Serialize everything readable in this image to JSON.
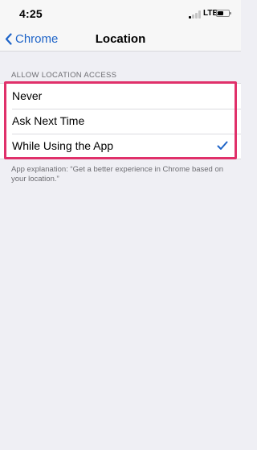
{
  "status_bar": {
    "time": "4:25",
    "network": "LTE",
    "battery_level": 0.55
  },
  "nav": {
    "back_label": "Chrome",
    "title": "Location"
  },
  "section": {
    "header": "ALLOW LOCATION ACCESS",
    "options": [
      {
        "label": "Never",
        "selected": false
      },
      {
        "label": "Ask Next Time",
        "selected": false
      },
      {
        "label": "While Using the App",
        "selected": true
      }
    ],
    "footer": "App explanation: “Get a better experience in Chrome based on your location.”"
  },
  "colors": {
    "accent": "#1e64c8",
    "highlight": "#e0306a",
    "background": "#efeff4"
  },
  "icons": {
    "back": "chevron-left-icon",
    "selected": "checkmark-icon",
    "battery": "battery-icon",
    "signal": "cellular-signal-icon"
  }
}
